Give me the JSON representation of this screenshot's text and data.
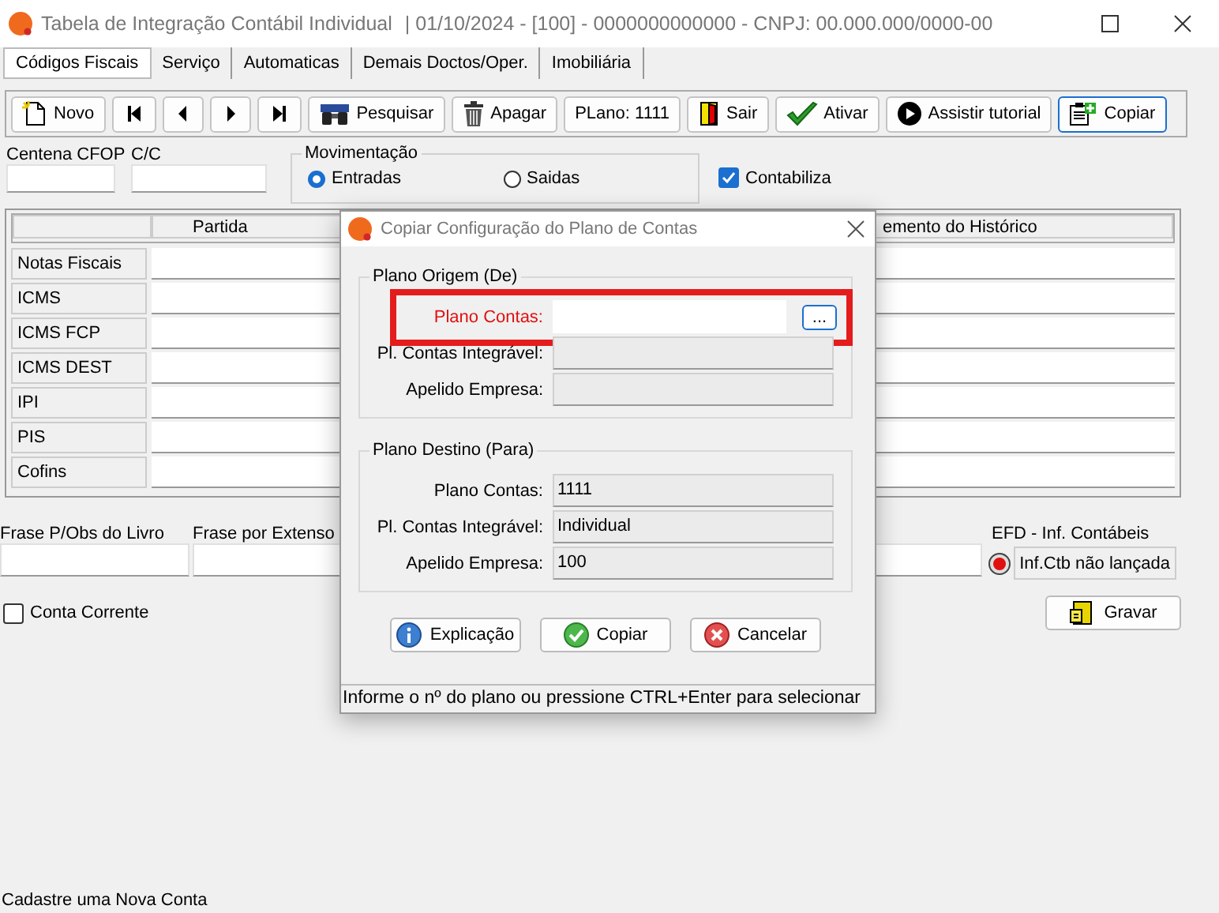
{
  "window": {
    "title": "Tabela de Integração Contábil Individual",
    "subtitle": "|  01/10/2024 - [100] - 0000000000000 - CNPJ: 00.000.000/0000-00"
  },
  "tabs": [
    {
      "label": "Códigos Fiscais",
      "selected": true
    },
    {
      "label": "Serviço",
      "selected": false
    },
    {
      "label": "Automaticas",
      "selected": false
    },
    {
      "label": "Demais Doctos/Oper.",
      "selected": false
    },
    {
      "label": "Imobiliária",
      "selected": false
    }
  ],
  "toolbar": [
    {
      "label": "Novo",
      "kind": "new",
      "focused": false
    },
    {
      "kind": "first",
      "focused": false
    },
    {
      "kind": "prev",
      "focused": false
    },
    {
      "kind": "next",
      "focused": false
    },
    {
      "kind": "last",
      "focused": false
    },
    {
      "label": "Pesquisar",
      "kind": "search",
      "focused": false
    },
    {
      "label": "Apagar",
      "kind": "delete",
      "focused": false
    },
    {
      "label": "PLano: 1111",
      "kind": "text",
      "focused": false
    },
    {
      "label": "Sair",
      "kind": "exit",
      "focused": false
    },
    {
      "label": "Ativar",
      "kind": "activate",
      "focused": false
    },
    {
      "label": "Assistir tutorial",
      "kind": "video",
      "focused": false
    },
    {
      "label": "Copiar",
      "kind": "copy",
      "focused": true
    }
  ],
  "filters": {
    "centena_cfop": {
      "label": "Centena CFOP"
    },
    "cc": {
      "label": "C/C"
    },
    "movimentacao": {
      "title": "Movimentação",
      "options": [
        {
          "label": "Entradas",
          "selected": true
        },
        {
          "label": "Saidas",
          "selected": false
        }
      ]
    },
    "contabiliza": {
      "label": "Contabiliza",
      "checked": true
    }
  },
  "grid": {
    "columns": [
      "Partida",
      "emento do Histórico"
    ],
    "rows": [
      "Notas Fiscais",
      "ICMS",
      "ICMS FCP",
      "ICMS DEST",
      "IPI",
      "PIS",
      "Cofins"
    ]
  },
  "frase_livro": {
    "label": "Frase P/Obs do Livro"
  },
  "frase_extenso": {
    "label": "Frase por Extenso"
  },
  "efd": {
    "label": "EFD - Inf. Contábeis",
    "button": "Inf.Ctb não lançada"
  },
  "conta_corrente": {
    "label": "Conta Corrente",
    "checked": false
  },
  "gravar": "Gravar",
  "dialog": {
    "title": "Copiar Configuração do Plano de Contas",
    "groups": [
      {
        "title": "Plano Origem (De)",
        "fields": [
          {
            "label": "Plano Contas:",
            "required": true,
            "highlighted": true,
            "disabled": false,
            "lookup": "..."
          },
          {
            "label": "Pl. Contas Integrável:",
            "required": false,
            "disabled": true
          },
          {
            "label": "Apelido Empresa:",
            "required": false,
            "disabled": true
          }
        ]
      },
      {
        "title": "Plano Destino (Para)",
        "fields": [
          {
            "label": "Plano Contas:",
            "value": "1111",
            "required": false,
            "disabled": true
          },
          {
            "label": "Pl. Contas Integrável:",
            "value": "Individual",
            "required": false,
            "disabled": true
          },
          {
            "label": "Apelido Empresa:",
            "value": "100",
            "required": false,
            "disabled": true
          }
        ]
      }
    ],
    "buttons": [
      {
        "label": "Explicação",
        "kind": "help"
      },
      {
        "label": "Copiar",
        "kind": "confirm"
      },
      {
        "label": "Cancelar",
        "kind": "cancel"
      }
    ],
    "hint": "Informe o nº do plano ou pressione CTRL+Enter para selecionar"
  },
  "status_bar": "Cadastre uma Nova Conta"
}
